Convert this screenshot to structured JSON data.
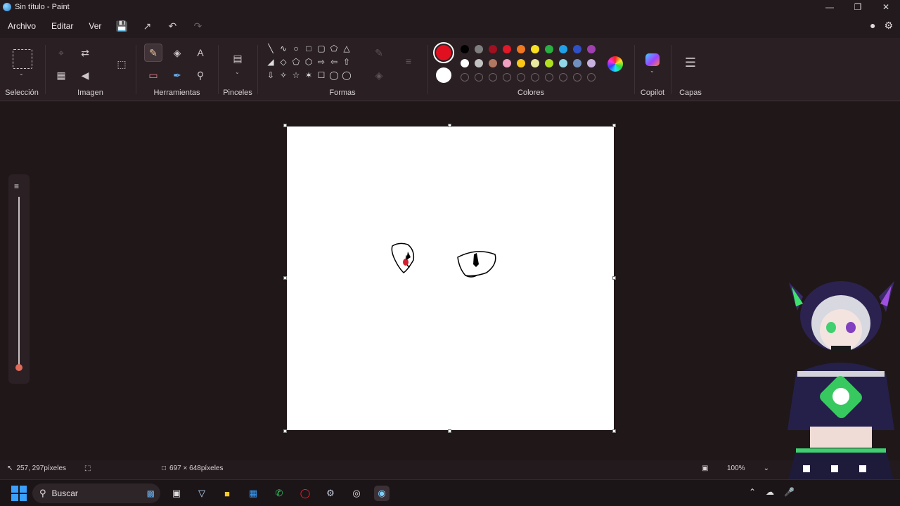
{
  "window": {
    "title": "Sin título - Paint"
  },
  "menu": {
    "items": [
      "Archivo",
      "Editar",
      "Ver"
    ]
  },
  "ribbon": {
    "groups": {
      "seleccion": "Selección",
      "imagen": "Imagen",
      "herramientas": "Herramientas",
      "pinceles": "Pinceles",
      "formas": "Formas",
      "colores": "Colores",
      "copilot": "Copilot",
      "capas": "Capas"
    },
    "text_tool_glyph": "A",
    "primary_color": "#e01020",
    "secondary_color": "#ffffff",
    "palette_row1": [
      "#000000",
      "#7f7f7f",
      "#a01020",
      "#e01828",
      "#f07820",
      "#f8e020",
      "#28b040",
      "#20a0e8",
      "#3050c8",
      "#a040b0"
    ],
    "palette_row2": [
      "#ffffff",
      "#c3c3c3",
      "#b07860",
      "#f0a0c0",
      "#f8c818",
      "#e8e8a0",
      "#b0e020",
      "#90d8e8",
      "#7090c0",
      "#c8b0e0"
    ]
  },
  "status": {
    "cursor_position": "257, 297píxeles",
    "canvas_size": "697 × 648píxeles",
    "zoom": "100%"
  },
  "taskbar": {
    "search_placeholder": "Buscar"
  }
}
